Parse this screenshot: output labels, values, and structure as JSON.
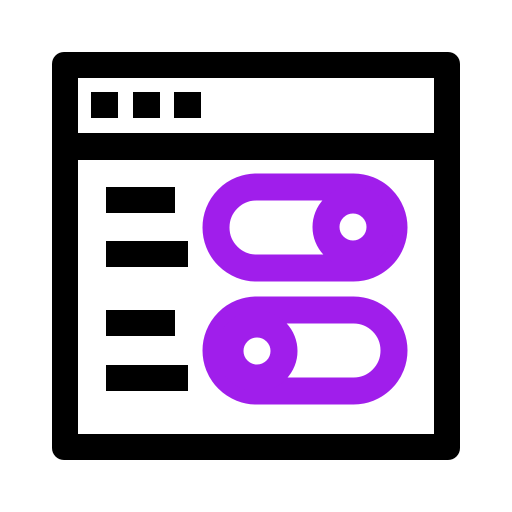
{
  "icon": {
    "name": "settings-toggles-window-icon",
    "colors": {
      "stroke": "#000000",
      "accent": "#A01EEB",
      "fill": "#ffffff"
    }
  },
  "window": {
    "title_bar_dots": 3
  },
  "settings": {
    "rows": [
      {
        "label_lines": 2,
        "toggle": {
          "state": "on",
          "knob": "right"
        }
      },
      {
        "label_lines": 2,
        "toggle": {
          "state": "off",
          "knob": "left"
        }
      }
    ]
  }
}
